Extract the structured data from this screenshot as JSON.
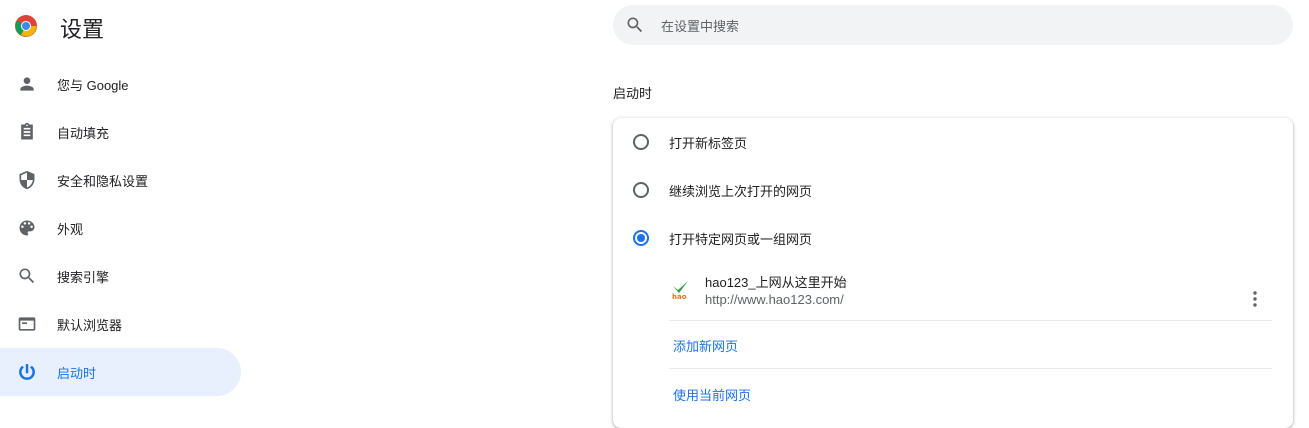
{
  "header": {
    "title": "设置",
    "logo_icon": "chrome-logo"
  },
  "search": {
    "placeholder": "在设置中搜索",
    "value": ""
  },
  "sidebar": {
    "items": [
      {
        "label": "您与 Google",
        "icon": "person-icon"
      },
      {
        "label": "自动填充",
        "icon": "clipboard-icon"
      },
      {
        "label": "安全和隐私设置",
        "icon": "shield-icon"
      },
      {
        "label": "外观",
        "icon": "palette-icon"
      },
      {
        "label": "搜索引擎",
        "icon": "search-icon"
      },
      {
        "label": "默认浏览器",
        "icon": "browser-window-icon"
      },
      {
        "label": "启动时",
        "icon": "power-icon",
        "active": true
      }
    ]
  },
  "startup": {
    "section_title": "启动时",
    "options": [
      {
        "label": "打开新标签页",
        "checked": false
      },
      {
        "label": "继续浏览上次打开的网页",
        "checked": false
      },
      {
        "label": "打开特定网页或一组网页",
        "checked": true
      }
    ],
    "pages": [
      {
        "title": "hao123_上网从这里开始",
        "url": "http://www.hao123.com/",
        "favicon": "hao123-icon"
      }
    ],
    "add_page_label": "添加新网页",
    "use_current_label": "使用当前网页"
  },
  "colors": {
    "accent": "#1a73e8",
    "active_bg": "#e8f0fe",
    "search_bg": "#f1f3f4"
  }
}
